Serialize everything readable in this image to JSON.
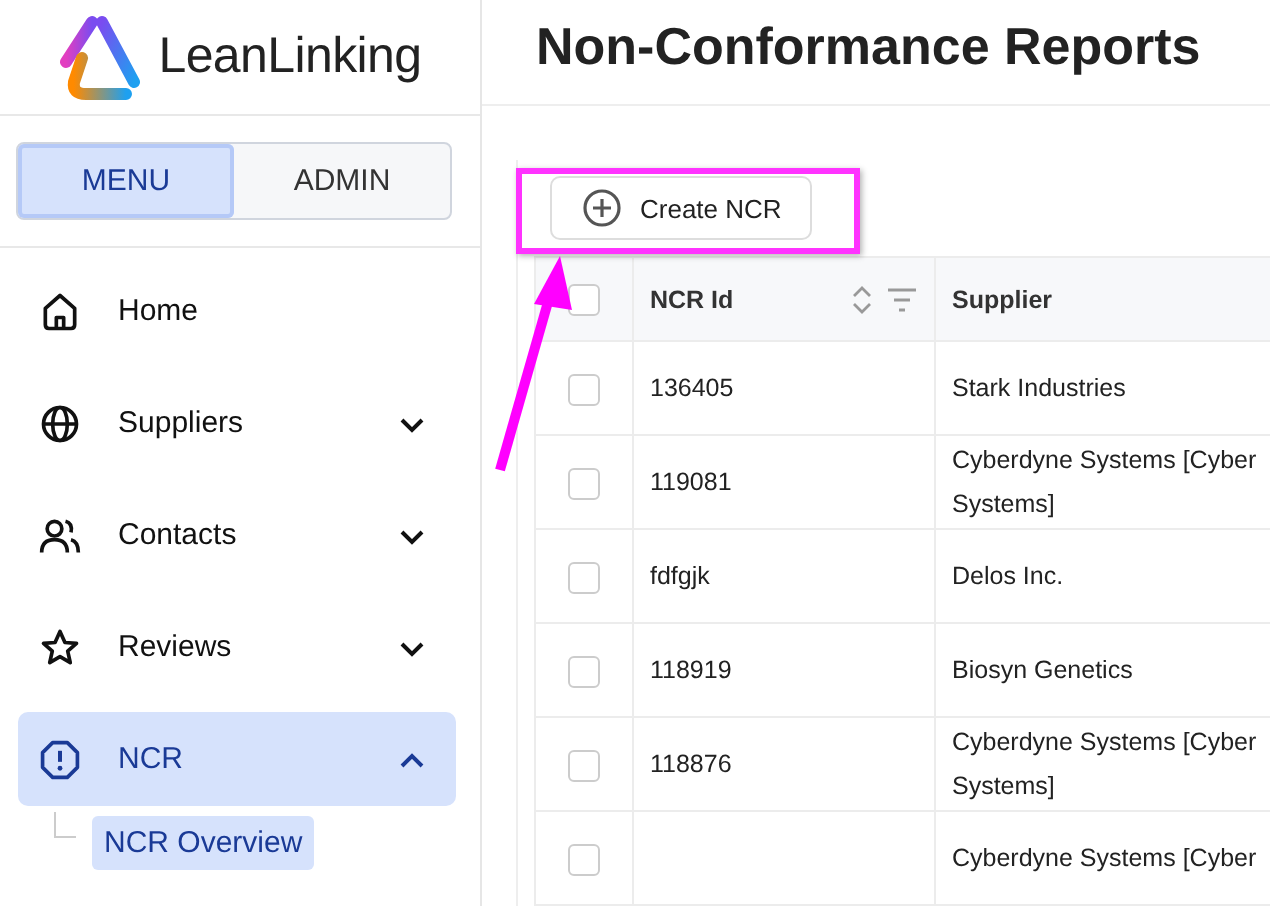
{
  "logo": {
    "text": "LeanLinking"
  },
  "mode_toggle": [
    {
      "label": "MENU",
      "selected": true
    },
    {
      "label": "ADMIN",
      "selected": false
    }
  ],
  "sidebar": {
    "items": [
      {
        "label": "Home",
        "selected": false
      },
      {
        "label": "Suppliers",
        "expanded": false,
        "selected": false
      },
      {
        "label": "Contacts",
        "expanded": false,
        "selected": false
      },
      {
        "label": "Reviews",
        "expanded": false,
        "selected": false
      },
      {
        "label": "NCR",
        "expanded": true,
        "selected": true,
        "children": [
          {
            "label": "NCR Overview",
            "selected": true
          }
        ]
      }
    ]
  },
  "page": {
    "title": "Non-Conformance Reports"
  },
  "toolbar": {
    "create_button": "Create NCR"
  },
  "table": {
    "all_checked": false,
    "columns": [
      "NCR Id",
      "Supplier"
    ],
    "rows": [
      {
        "checked": false,
        "cells": [
          [
            "136405"
          ],
          [
            "Stark Industries"
          ]
        ]
      },
      {
        "checked": false,
        "cells": [
          [
            "119081"
          ],
          [
            "Cyberdyne Systems [Cyber",
            "Systems]"
          ]
        ]
      },
      {
        "checked": false,
        "cells": [
          [
            "fdfgjk"
          ],
          [
            "Delos Inc."
          ]
        ]
      },
      {
        "checked": false,
        "cells": [
          [
            "118919"
          ],
          [
            "Biosyn Genetics"
          ]
        ]
      },
      {
        "checked": false,
        "cells": [
          [
            "118876"
          ],
          [
            "Cyberdyne Systems [Cyber",
            "Systems]"
          ]
        ]
      },
      {
        "checked": false,
        "cells": [
          [],
          [
            "Cyberdyne Systems [Cyber"
          ]
        ]
      }
    ]
  }
}
